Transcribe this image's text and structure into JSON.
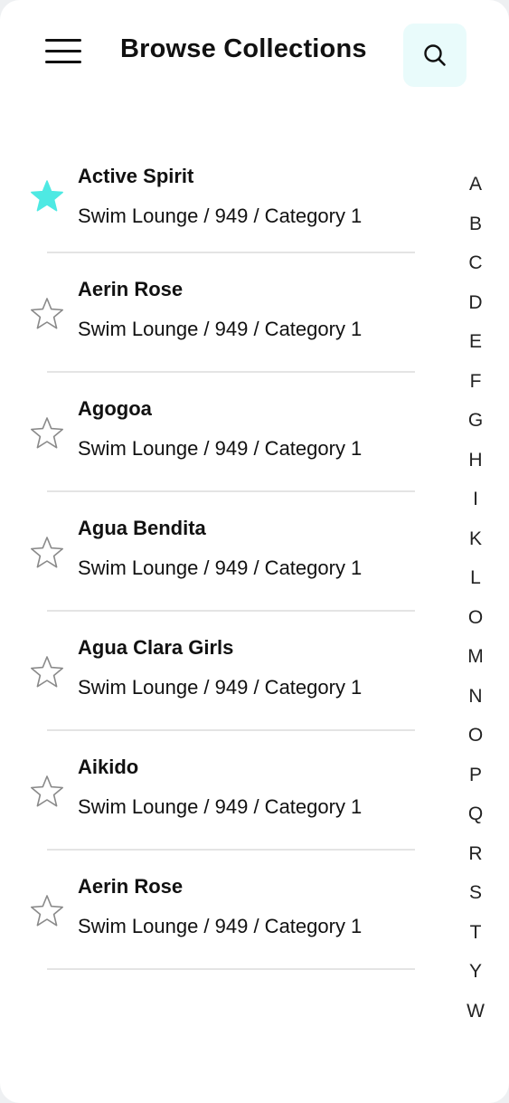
{
  "header": {
    "title": "Browse Collections",
    "menu_icon": "hamburger-menu-icon",
    "search_icon": "search-icon",
    "search_bg": "#e9fbfb"
  },
  "colors": {
    "accent": "#4ee9e3",
    "text": "#111111",
    "divider": "#e4e4e4",
    "star_outline": "#8a8a8a"
  },
  "collections": [
    {
      "name": "Active Spirit",
      "meta": "Swim Lounge / 949 / Category 1",
      "favorite": true
    },
    {
      "name": "Aerin Rose",
      "meta": "Swim Lounge / 949 / Category 1",
      "favorite": false
    },
    {
      "name": "Agogoa",
      "meta": "Swim Lounge / 949 / Category 1",
      "favorite": false
    },
    {
      "name": "Agua Bendita",
      "meta": "Swim Lounge / 949 / Category 1",
      "favorite": false
    },
    {
      "name": "Agua Clara Girls",
      "meta": "Swim Lounge / 949 / Category 1",
      "favorite": false
    },
    {
      "name": "Aikido",
      "meta": "Swim Lounge / 949 / Category 1",
      "favorite": false
    },
    {
      "name": "Aerin Rose",
      "meta": "Swim Lounge / 949 / Category 1",
      "favorite": false
    }
  ],
  "alphabet_index": [
    "A",
    "B",
    "C",
    "D",
    "E",
    "F",
    "G",
    "H",
    "I",
    "K",
    "L",
    "O",
    "M",
    "N",
    "O",
    "P",
    "Q",
    "R",
    "S",
    "T",
    "Y",
    "W"
  ]
}
